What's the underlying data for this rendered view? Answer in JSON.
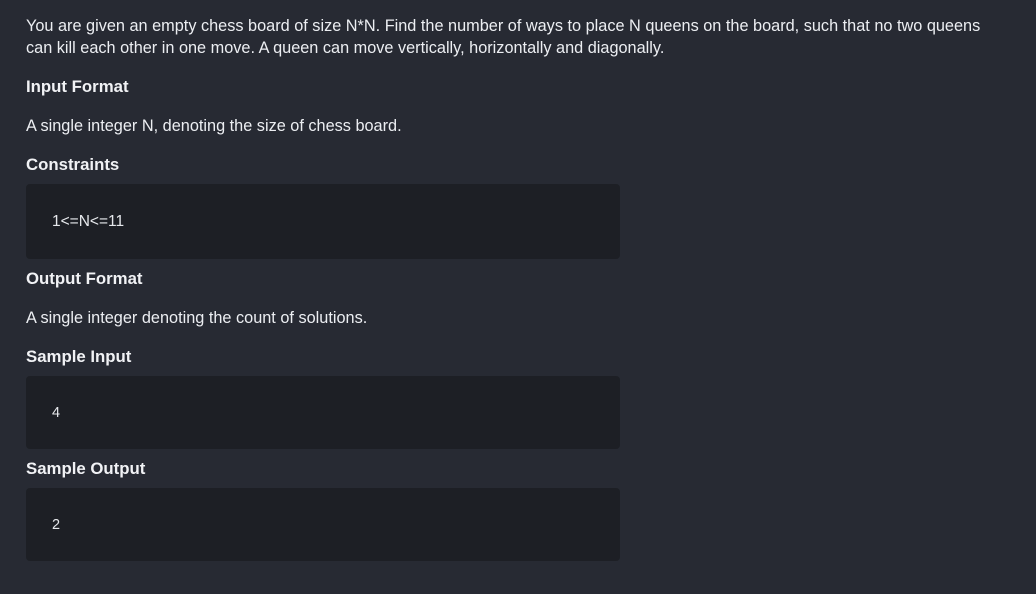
{
  "problem": {
    "description": "You are given an empty chess board of size N*N. Find the number of ways to place N queens on the board, such that no two queens can kill each other in one move. A queen can move vertically, horizontally and diagonally.",
    "input_format_heading": "Input Format",
    "input_format_text": "A single integer N, denoting the size of chess board.",
    "constraints_heading": "Constraints",
    "constraints_text": "1<=N<=11",
    "output_format_heading": "Output Format",
    "output_format_text": "A single integer denoting the count of solutions.",
    "sample_input_heading": "Sample Input",
    "sample_input_text": "4",
    "sample_output_heading": "Sample Output",
    "sample_output_text": "2"
  },
  "colors": {
    "background": "#272a33",
    "code_box": "#1d1f25",
    "text": "#eceef2"
  }
}
